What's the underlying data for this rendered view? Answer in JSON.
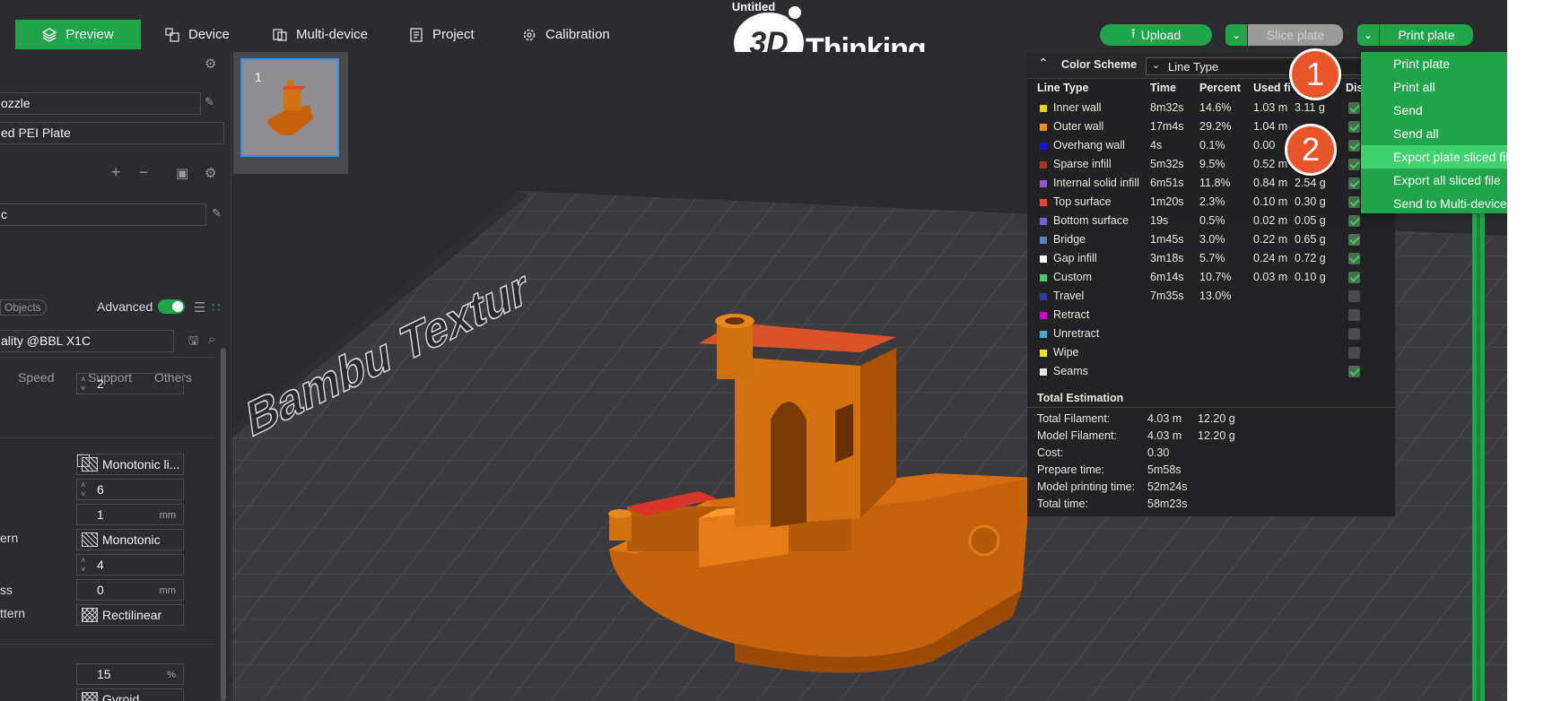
{
  "window": {
    "title": "Untitled"
  },
  "tabs": [
    {
      "label": "Preview",
      "icon": "layers-icon",
      "active": true
    },
    {
      "label": "Device",
      "icon": "device-icon"
    },
    {
      "label": "Multi-device",
      "icon": "multi-device-icon"
    },
    {
      "label": "Project",
      "icon": "project-icon"
    },
    {
      "label": "Calibration",
      "icon": "calibration-icon"
    }
  ],
  "logo": {
    "mark": "3D",
    "text": "Thinking"
  },
  "actions": {
    "upload_label": "Upload",
    "slice_label": "Slice plate",
    "print_label": "Print plate"
  },
  "print_menu": {
    "items": [
      {
        "label": "Print plate"
      },
      {
        "label": "Print all"
      },
      {
        "label": "Send"
      },
      {
        "label": "Send all"
      },
      {
        "label": "Export plate sliced file",
        "highlighted": true
      },
      {
        "label": "Export all sliced file"
      },
      {
        "label": "Send to Multi-device"
      }
    ]
  },
  "badges": {
    "first": "1",
    "second": "2"
  },
  "sidebar": {
    "nozzle": "ozzle",
    "plate": "ed PEI Plate",
    "filament": "c",
    "objects_label": "Objects",
    "advanced_label": "Advanced",
    "process": "ality @BBL X1C",
    "subtabs": [
      "Speed",
      "Support",
      "Others"
    ],
    "settings": {
      "wall_loops": "2",
      "top_pattern": "Monotonic li...",
      "top_layers": "6",
      "top_thickness": "1",
      "top_thickness_unit": "mm",
      "bottom_pattern_label": "ern",
      "bottom_pattern": "Monotonic",
      "bottom_layers": "4",
      "bottom_thickness_label": "ss",
      "bottom_thickness": "0",
      "bottom_thickness_unit": "mm",
      "internal_pattern_label": "ttern",
      "internal_pattern": "Rectilinear",
      "infill_density": "15",
      "infill_unit": "%",
      "infill_pattern": "Gyroid"
    }
  },
  "plate_thumb": {
    "number": "1"
  },
  "bed_text": "Bambu Textur",
  "legend": {
    "title": "Color Scheme",
    "scheme": "Line Type",
    "columns": {
      "type": "Line Type",
      "time": "Time",
      "percent": "Percent",
      "used_filament": "Used fi",
      "display": "Dis"
    },
    "rows": [
      {
        "name": "Inner wall",
        "color": "#f2d200",
        "time": "8m32s",
        "percent": "14.6%",
        "used_m": "1.03 m",
        "used_g": "3.11 g",
        "shown": true
      },
      {
        "name": "Outer wall",
        "color": "#ff8a1c",
        "time": "17m4s",
        "percent": "29.2%",
        "used_m": "1.04 m",
        "used_g": "",
        "shown": true
      },
      {
        "name": "Overhang wall",
        "color": "#1010ff",
        "time": "4s",
        "percent": "0.1%",
        "used_m": "0.00",
        "used_g": "",
        "shown": true
      },
      {
        "name": "Sparse infill",
        "color": "#b3301e",
        "time": "5m32s",
        "percent": "9.5%",
        "used_m": "0.52 m",
        "used_g": "",
        "shown": true
      },
      {
        "name": "Internal solid infill",
        "color": "#9b4fd6",
        "time": "6m51s",
        "percent": "11.8%",
        "used_m": "0.84 m",
        "used_g": "2.54 g",
        "shown": true
      },
      {
        "name": "Top surface",
        "color": "#f0443a",
        "time": "1m20s",
        "percent": "2.3%",
        "used_m": "0.10 m",
        "used_g": "0.30 g",
        "shown": true
      },
      {
        "name": "Bottom surface",
        "color": "#7262d6",
        "time": "19s",
        "percent": "0.5%",
        "used_m": "0.02 m",
        "used_g": "0.05 g",
        "shown": true
      },
      {
        "name": "Bridge",
        "color": "#4f86c6",
        "time": "1m45s",
        "percent": "3.0%",
        "used_m": "0.22 m",
        "used_g": "0.65 g",
        "shown": true
      },
      {
        "name": "Gap infill",
        "color": "#ffffff",
        "time": "3m18s",
        "percent": "5.7%",
        "used_m": "0.24 m",
        "used_g": "0.72 g",
        "shown": true
      },
      {
        "name": "Custom",
        "color": "#3fcf6a",
        "time": "6m14s",
        "percent": "10.7%",
        "used_m": "0.03 m",
        "used_g": "0.10 g",
        "shown": true
      },
      {
        "name": "Travel",
        "color": "#2b3fa8",
        "time": "7m35s",
        "percent": "13.0%",
        "used_m": "",
        "used_g": "",
        "shown": false
      },
      {
        "name": "Retract",
        "color": "#d000d0",
        "time": "",
        "percent": "",
        "used_m": "",
        "used_g": "",
        "shown": false
      },
      {
        "name": "Unretract",
        "color": "#3fa8d8",
        "time": "",
        "percent": "",
        "used_m": "",
        "used_g": "",
        "shown": false
      },
      {
        "name": "Wipe",
        "color": "#f2e600",
        "time": "",
        "percent": "",
        "used_m": "",
        "used_g": "",
        "shown": false
      },
      {
        "name": "Seams",
        "color": "#eaeaea",
        "time": "",
        "percent": "",
        "used_m": "",
        "used_g": "",
        "shown": true
      }
    ],
    "total_title": "Total Estimation",
    "totals": [
      {
        "label": "Total Filament:",
        "a": "4.03 m",
        "b": "12.20 g"
      },
      {
        "label": "Model Filament:",
        "a": "4.03 m",
        "b": "12.20 g"
      },
      {
        "label": "Cost:",
        "a": "0.30",
        "b": ""
      },
      {
        "label": "Prepare time:",
        "a": "5m58s",
        "b": ""
      },
      {
        "label": "Model printing time:",
        "a": "52m24s",
        "b": ""
      },
      {
        "label": "Total time:",
        "a": "58m23s",
        "b": ""
      }
    ]
  }
}
